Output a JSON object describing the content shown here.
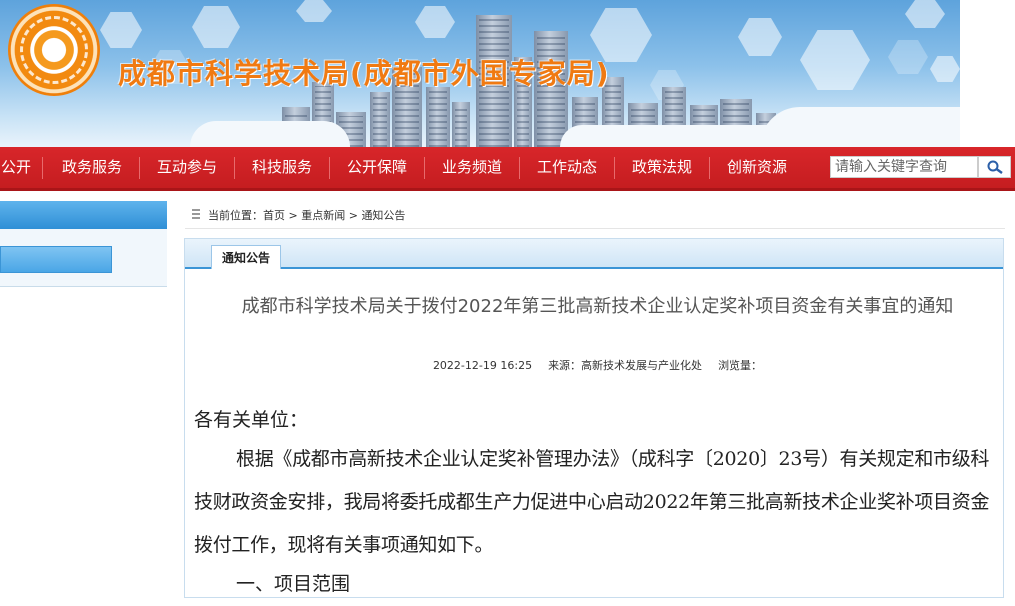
{
  "header": {
    "site_title": "成都市科学技术局(成都市外国专家局)"
  },
  "nav": {
    "items": [
      "公开",
      "政务服务",
      "互动参与",
      "科技服务",
      "公开保障",
      "业务频道",
      "工作动态",
      "政策法规",
      "创新资源"
    ],
    "search_placeholder": "请输入关键字查询"
  },
  "breadcrumb": {
    "prefix": "当前位置：",
    "path": [
      "首页",
      "重点新闻",
      "通知公告"
    ],
    "separator": " > "
  },
  "content": {
    "tab_label": "通知公告",
    "article": {
      "title": "成都市科学技术局关于拨付2022年第三批高新技术企业认定奖补项目资金有关事宜的通知",
      "date": "2022-12-19 16:25",
      "source_label": "来源：",
      "source": "高新技术发展与产业化处",
      "views_label": "浏览量：",
      "salutation": "各有关单位：",
      "paragraph": "根据《成都市高新技术企业认定奖补管理办法》（成科字〔2020〕23号）有关规定和市级科技财政资金安排，我局将委托成都生产力促进中心启动2022年第三批高新技术企业奖补项目资金拨付工作，现将有关事项通知如下。",
      "section_1": "一、项目范围"
    }
  },
  "colors": {
    "nav_red": "#c51d20",
    "title_orange": "#f07a12",
    "accent_blue": "#3b95d6"
  }
}
